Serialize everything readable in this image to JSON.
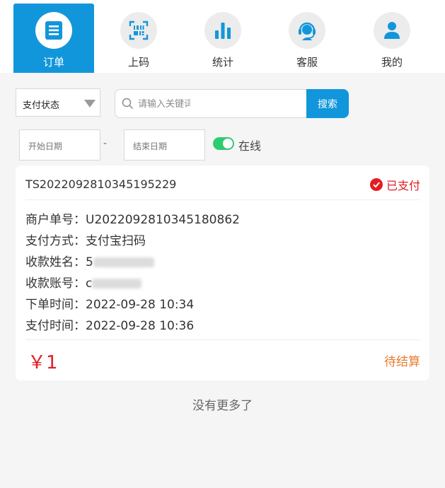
{
  "nav": {
    "items": [
      {
        "label": "订单",
        "icon": "order-list-icon",
        "active": true
      },
      {
        "label": "上码",
        "icon": "barcode-icon",
        "active": false
      },
      {
        "label": "统计",
        "icon": "bar-chart-icon",
        "active": false
      },
      {
        "label": "客服",
        "icon": "headset-icon",
        "active": false
      },
      {
        "label": "我的",
        "icon": "user-icon",
        "active": false
      }
    ]
  },
  "filters": {
    "status_select": "支付状态",
    "search_placeholder": "请输入关键词",
    "search_button": "搜索",
    "start_date_placeholder": "开始日期",
    "end_date_placeholder": "结束日期",
    "date_separator": "-",
    "online_toggle_label": "在线",
    "online_toggle_on": true
  },
  "order": {
    "order_no": "TS2022092810345195229",
    "status": "已支付",
    "merchant_no_label": "商户单号：",
    "merchant_no": "U2022092810345180862",
    "pay_method_label": "支付方式：",
    "pay_method": "支付宝扫码",
    "payee_name_label": "收款姓名：",
    "payee_name_partial": "5",
    "payee_account_label": "收款账号：",
    "payee_account_partial": "c",
    "order_time_label": "下单时间：",
    "order_time": "2022-09-28 10:34",
    "pay_time_label": "支付时间：",
    "pay_time": "2022-09-28 10:36",
    "amount": "￥1",
    "settle_status": "待结算"
  },
  "footer": {
    "no_more": "没有更多了"
  },
  "colors": {
    "primary": "#1296db",
    "paid_red": "#e41c24",
    "settle_orange": "#e87a2d",
    "toggle_green": "#2ecc71",
    "background": "#f5f5f5"
  }
}
